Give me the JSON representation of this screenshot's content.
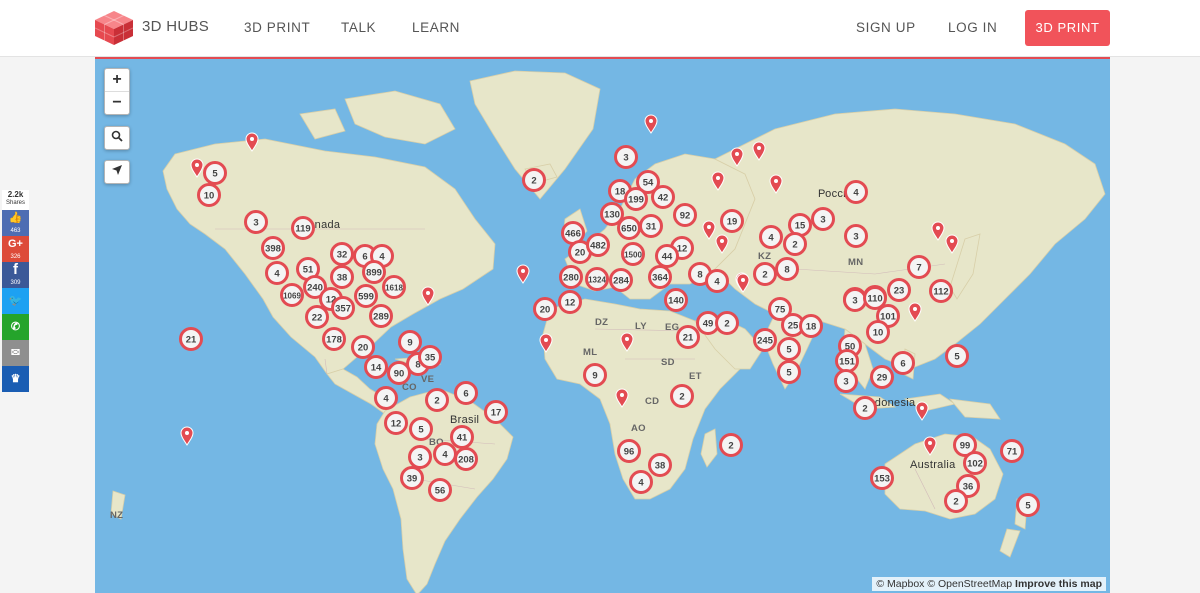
{
  "header": {
    "brand": "3D HUBS",
    "nav": [
      "3D PRINT",
      "TALK",
      "LEARN"
    ],
    "sign_up": "SIGN UP",
    "log_in": "LOG IN",
    "cta": "3D PRINT"
  },
  "social": {
    "total": "2.2k",
    "total_label": "Shares",
    "like_count": "463",
    "gplus_label": "G+",
    "gplus_count": "326",
    "fb_label": "f",
    "fb_count": "309"
  },
  "map": {
    "zoom_in": "+",
    "zoom_out": "−",
    "attribution_1": "© Mapbox © OpenStreetMap",
    "attribution_2": "Improve this map",
    "labels": {
      "canada": "Canada",
      "russia": "Россия",
      "brasil": "Brasil",
      "australia": "Australia",
      "indonesia": "Indonesia",
      "kz": "KZ",
      "mn": "MN",
      "dz": "DZ",
      "ly": "LY",
      "eg": "EG",
      "ml": "ML",
      "sd": "SD",
      "et": "ET",
      "cd": "CD",
      "ao": "AO",
      "nz": "NZ",
      "co": "CO",
      "ve": "VE",
      "bo": "BO"
    },
    "clusters": [
      "5",
      "10",
      "3",
      "119",
      "398",
      "4",
      "51",
      "32",
      "6",
      "4",
      "899",
      "38",
      "1069",
      "240",
      "1618",
      "599",
      "12",
      "357",
      "22",
      "289",
      "178",
      "21",
      "20",
      "9",
      "14",
      "8",
      "35",
      "90",
      "4",
      "2",
      "6",
      "12",
      "5",
      "17",
      "41",
      "3",
      "4",
      "208",
      "39",
      "56",
      "2",
      "3",
      "54",
      "18",
      "199",
      "42",
      "130",
      "92",
      "466",
      "650",
      "31",
      "19",
      "15",
      "3",
      "4",
      "2",
      "20",
      "482",
      "12",
      "1500",
      "44",
      "280",
      "1324",
      "284",
      "364",
      "8",
      "2",
      "4",
      "8",
      "7",
      "3",
      "140",
      "20",
      "12",
      "21",
      "49",
      "2",
      "75",
      "25",
      "18",
      "245",
      "5",
      "5",
      "9",
      "2",
      "96",
      "38",
      "4",
      "2",
      "4",
      "3",
      "7",
      "3",
      "110",
      "23",
      "112",
      "101",
      "10",
      "50",
      "151",
      "3",
      "6",
      "29",
      "2",
      "5",
      "99",
      "102",
      "36",
      "153",
      "2",
      "71",
      "5"
    ]
  }
}
